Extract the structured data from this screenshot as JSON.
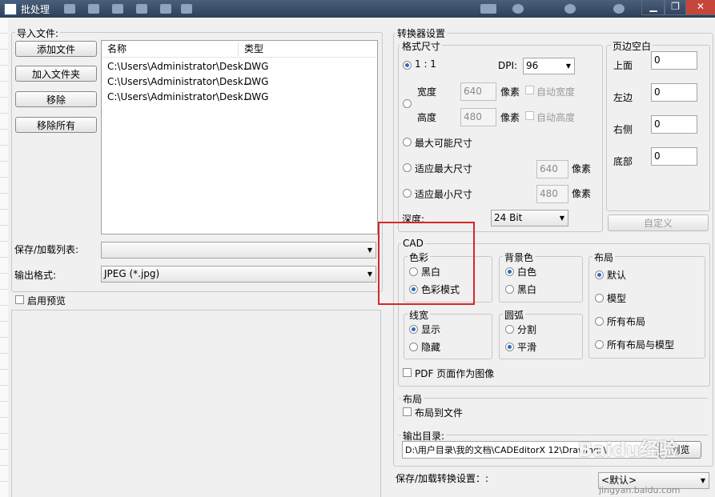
{
  "window": {
    "title": "批处理",
    "controls": [
      "▁",
      "❐",
      "✕"
    ]
  },
  "left": {
    "import_label": "导入文件:",
    "buttons": {
      "add_file": "添加文件",
      "add_folder": "加入文件夹",
      "remove": "移除",
      "remove_all": "移除所有"
    },
    "columns": [
      "名称",
      "类型"
    ],
    "files": [
      {
        "name": "C:\\Users\\Administrator\\Desk...",
        "type": "DWG"
      },
      {
        "name": "C:\\Users\\Administrator\\Desk...",
        "type": "DWG"
      },
      {
        "name": "C:\\Users\\Administrator\\Desk...",
        "type": "DWG"
      }
    ],
    "save_load_list_label": "保存/加载列表:",
    "save_load_list_value": "",
    "output_format_label": "输出格式:",
    "output_format_value": "JPEG (*.jpg)",
    "enable_preview_label": "启用预览"
  },
  "converter": {
    "title": "转换器设置",
    "format_size": {
      "title": "格式尺寸",
      "ratio_label": "1 : 1",
      "dpi_label": "DPI:",
      "dpi_value": "96",
      "width_label": "宽度",
      "width_value": "640",
      "height_label": "高度",
      "height_value": "480",
      "pixel_label": "像素",
      "auto_width_label": "自动宽度",
      "auto_height_label": "自动高度",
      "max_possible_label": "最大可能尺寸",
      "fit_max_label": "适应最大尺寸",
      "fit_max_value": "640",
      "fit_min_label": "适应最小尺寸",
      "fit_min_value": "480",
      "depth_label": "深度:",
      "depth_value": "24 Bit"
    },
    "margins": {
      "title": "页边空白",
      "top_label": "上面",
      "top_value": "0",
      "left_label": "左边",
      "left_value": "0",
      "right_label": "右侧",
      "right_value": "0",
      "bottom_label": "底部",
      "bottom_value": "0",
      "custom_button": "自定义"
    },
    "cad": {
      "title": "CAD",
      "color": {
        "title": "色彩",
        "bw_label": "黑白",
        "color_mode_label": "色彩模式"
      },
      "background": {
        "title": "背景色",
        "white_label": "白色",
        "black_label": "黑白"
      },
      "layout": {
        "title": "布局",
        "default_label": "默认",
        "model_label": "模型",
        "all_layouts_label": "所有布局",
        "all_layouts_model_label": "所有布局与模型"
      },
      "lineweight": {
        "title": "线宽",
        "show_label": "显示",
        "hide_label": "隐藏"
      },
      "arc": {
        "title": "圆弧",
        "split_label": "分割",
        "smooth_label": "平滑"
      },
      "pdf_as_image_label": "PDF 页面作为图像"
    },
    "layout_section": {
      "title": "布局",
      "layout_to_file_label": "布局到文件"
    },
    "output_dir": {
      "label": "输出目录:",
      "value": "D:\\用户目录\\我的文档\\CADEditorX 12\\Drawings\\",
      "browse_button": "浏览"
    },
    "save_load_settings_label": "保存/加载转换设置：:",
    "save_load_settings_value": "<默认>"
  },
  "watermark": {
    "text": "Baidu经验",
    "subtext": "jingyan.baidu.com"
  },
  "colors": {
    "titlebar": "#2d3f58",
    "highlight_box": "#d8262a",
    "radio_on": "#2d6bc4"
  }
}
